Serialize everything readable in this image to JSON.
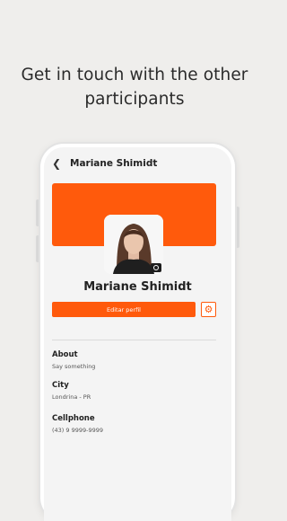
{
  "headline": {
    "line1": "Get in touch with the other",
    "line2": "participants"
  },
  "header": {
    "back_icon": "chevron-left-icon",
    "title": "Mariane Shimidt"
  },
  "profile": {
    "name": "Mariane Shimidt",
    "edit_label": "Editar perfil",
    "camera_icon": "camera-icon",
    "settings_icon": "gear-icon"
  },
  "details": {
    "about_label": "About",
    "about_value": "Say something",
    "city_label": "City",
    "city_value": "Londrina - PR",
    "cellphone_label": "Cellphone",
    "cellphone_value": "(43) 9 9999-9999"
  },
  "colors": {
    "accent": "#ff5a0c",
    "background": "#efeeec"
  }
}
